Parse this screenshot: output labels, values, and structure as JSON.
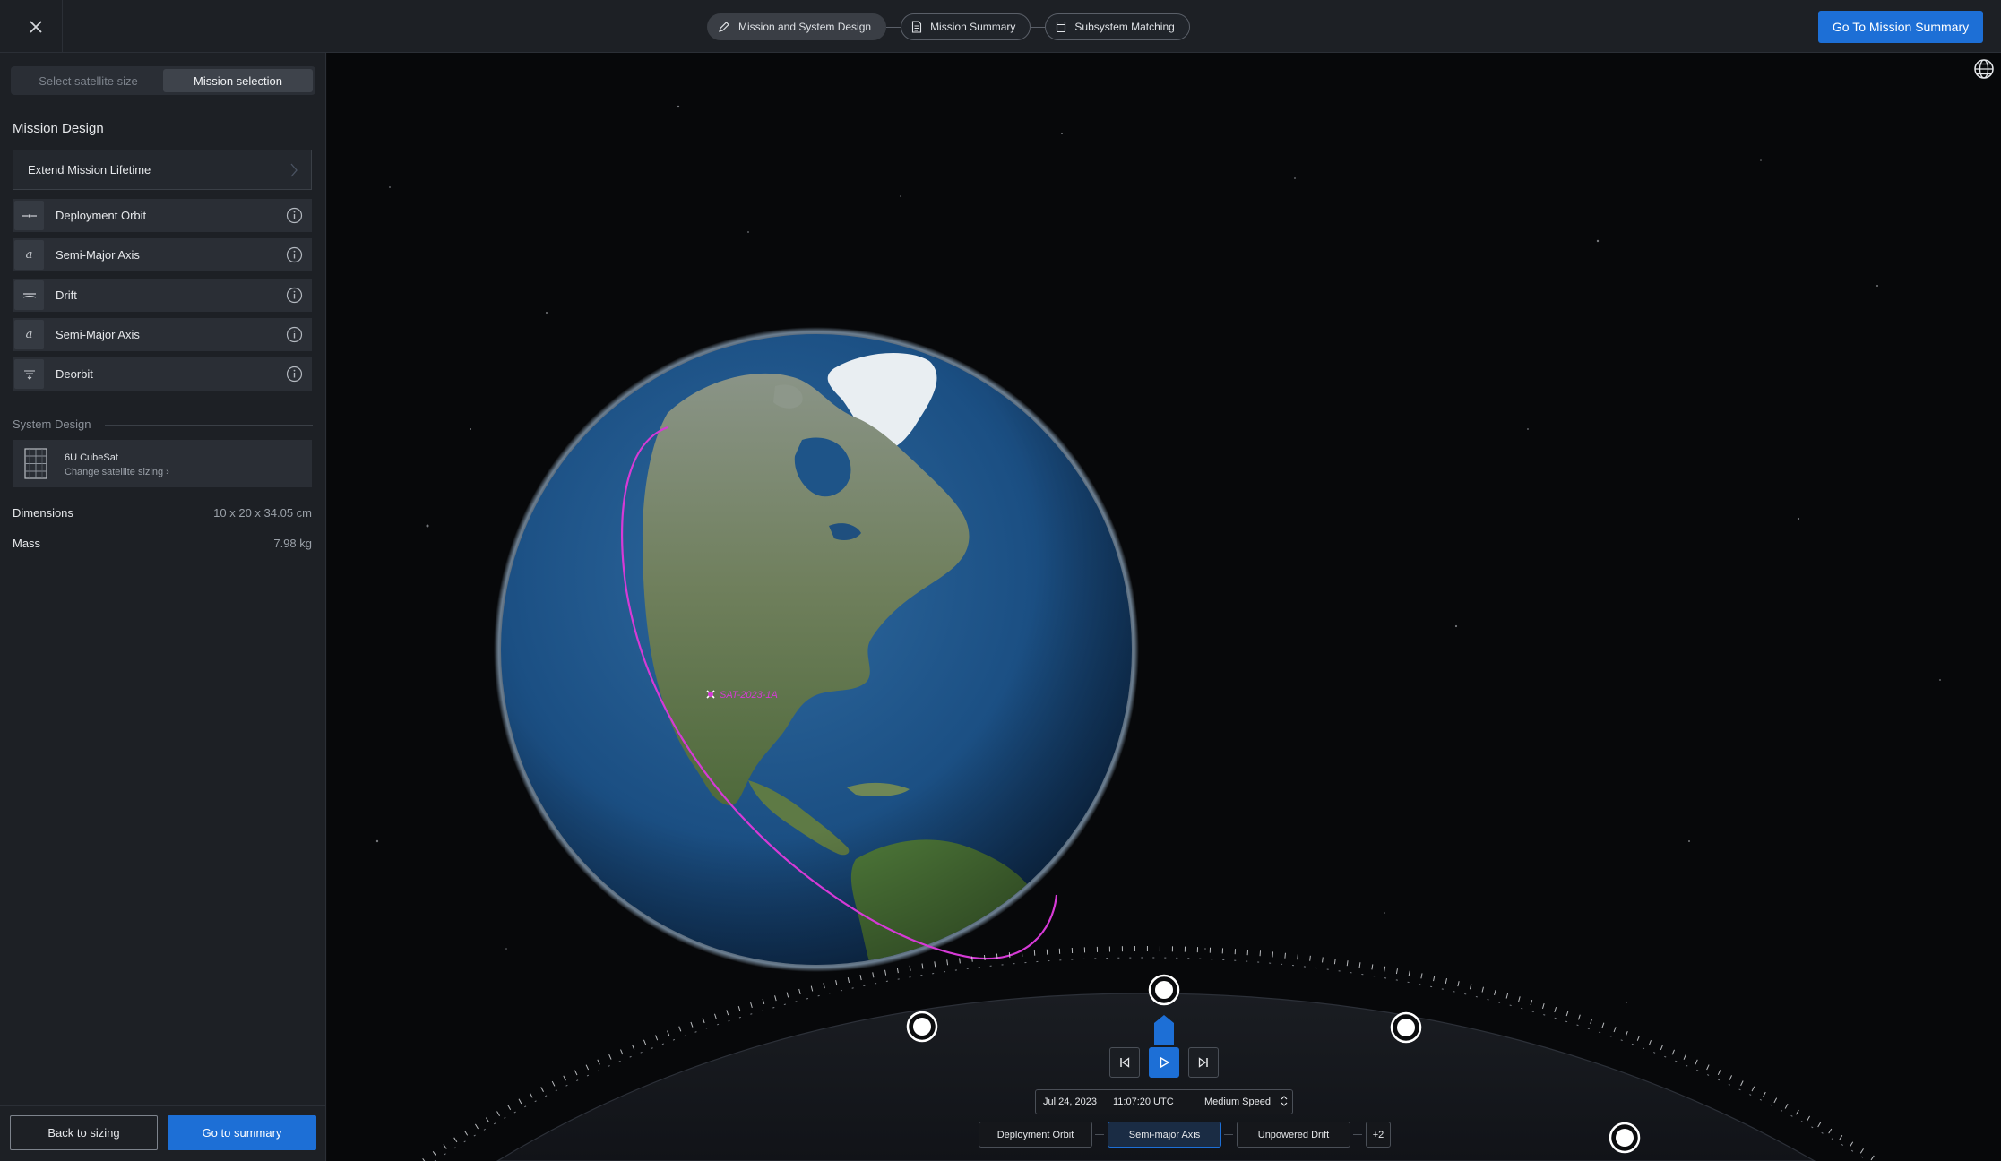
{
  "header": {
    "close_icon": "close-icon",
    "steps": [
      {
        "label": "Mission and System Design",
        "icon": "pencil-icon"
      },
      {
        "label": "Mission Summary",
        "icon": "document-icon"
      },
      {
        "label": "Subsystem Matching",
        "icon": "cube-icon"
      }
    ],
    "primary_label": "Go To Mission Summary"
  },
  "sidebar": {
    "tabs": [
      "Select satellite size",
      "Mission selection"
    ],
    "mission_title": "Mission Design",
    "extend_label": "Extend Mission Lifetime",
    "phases": [
      {
        "label": "Deployment Orbit",
        "icon": "orbit-icon"
      },
      {
        "label": "Semi-Major Axis",
        "icon": "a"
      },
      {
        "label": "Drift",
        "icon": "drift-icon"
      },
      {
        "label": "Semi-Major Axis",
        "icon": "a"
      },
      {
        "label": "Deorbit",
        "icon": "deorbit-icon"
      }
    ],
    "system_title": "System Design",
    "satellite": {
      "name": "6U CubeSat",
      "link": "Change satellite sizing"
    },
    "specs": [
      {
        "key": "Dimensions",
        "value": "10 x 20 x 34.05 cm"
      },
      {
        "key": "Mass",
        "value": "7.98 kg"
      }
    ],
    "back_label": "Back to sizing",
    "summary_label": "Go to summary"
  },
  "viewer": {
    "date": "Jul 24, 2023",
    "time": "11:07:20 UTC",
    "speed": "Medium Speed",
    "phase_chips": [
      "Deployment Orbit",
      "Semi-major Axis",
      "Unpowered Drift",
      "+2"
    ],
    "active_chip": 1,
    "satellite_label": "SAT-2023-1A",
    "colors": {
      "orbit": "#d63ad6",
      "accent": "#1d6fd6"
    }
  }
}
